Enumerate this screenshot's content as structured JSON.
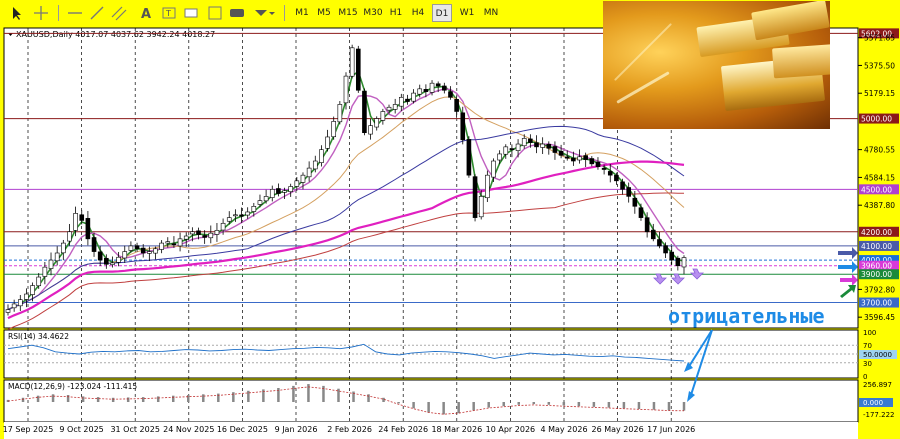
{
  "toolbar": {
    "timeframes": [
      "M1",
      "M5",
      "M15",
      "M30",
      "H1",
      "H4",
      "D1",
      "W1",
      "MN"
    ],
    "active_timeframe": "D1",
    "tools": [
      "cursor-icon",
      "crosshair-icon",
      "horizontal-line-icon",
      "trendline-icon",
      "channel-icon",
      "text-icon",
      "label-icon",
      "rectangle-icon",
      "shapes-icon"
    ]
  },
  "chart_data": {
    "type": "candlestick",
    "symbol_header": "XAUUSD,Daily  4017.07 4037.62 3942.24 4018.27",
    "x_ticks": [
      "17 Sep 2025",
      "9 Oct 2025",
      "31 Oct 2025",
      "24 Nov 2025",
      "16 Dec 2025",
      "9 Jan 2026",
      "2 Feb 2026",
      "24 Feb 2026",
      "18 Mar 2026",
      "10 Apr 2026",
      "4 May 2026",
      "26 May 2026",
      "17 Jun 2026"
    ],
    "y_ticks": [
      "5571.85",
      "5375.50",
      "5179.15",
      "4780.55",
      "4584.15",
      "4387.80",
      "3792.80",
      "3596.45"
    ],
    "ylim": [
      3520,
      5640
    ],
    "levels": [
      {
        "label": "5602.00",
        "value": 5602,
        "color": "#8b1a1a"
      },
      {
        "label": "5000.00",
        "value": 5000,
        "color": "#8b1a1a"
      },
      {
        "label": "4500.00",
        "value": 4500,
        "color": "#b040d0"
      },
      {
        "label": "4200.00",
        "value": 4200,
        "color": "#8b1a1a"
      },
      {
        "label": "4100.00",
        "value": 4100,
        "color": "#4a5aa8"
      },
      {
        "label": "4000.00",
        "value": 4000,
        "color": "#1a6fd8"
      },
      {
        "label": "3960.00",
        "value": 3960,
        "color": "#d83ad8"
      },
      {
        "label": "3900.00",
        "value": 3900,
        "color": "#1a8a3a"
      },
      {
        "label": "3700.00",
        "value": 3700,
        "color": "#3a6ac8"
      }
    ],
    "price_close": [
      3650,
      3690,
      3720,
      3760,
      3820,
      3880,
      3950,
      4000,
      4050,
      4120,
      4200,
      4330,
      4280,
      4150,
      4060,
      4000,
      3970,
      3980,
      4020,
      4060,
      4100,
      4080,
      4050,
      4060,
      4080,
      4120,
      4130,
      4110,
      4150,
      4170,
      4200,
      4180,
      4160,
      4190,
      4210,
      4260,
      4300,
      4320,
      4310,
      4340,
      4380,
      4420,
      4450,
      4500,
      4470,
      4490,
      4520,
      4560,
      4600,
      4650,
      4700,
      4780,
      4870,
      4980,
      5100,
      5300,
      5500,
      5200,
      4900,
      4950,
      5000,
      5050,
      5080,
      5100,
      5150,
      5120,
      5180,
      5210,
      5190,
      5250,
      5230,
      5200,
      5150,
      5050,
      4850,
      4600,
      4300,
      4450,
      4600,
      4700,
      4750,
      4800,
      4780,
      4820,
      4860,
      4830,
      4800,
      4820,
      4790,
      4760,
      4740,
      4720,
      4700,
      4730,
      4710,
      4680,
      4660,
      4640,
      4600,
      4560,
      4500,
      4450,
      4380,
      4300,
      4200,
      4150,
      4100,
      4050,
      4000,
      3960,
      4018
    ],
    "ma_lines": [
      {
        "name": "MA fast",
        "color": "#2e8b2e"
      },
      {
        "name": "MA mid",
        "color": "#c060c0"
      },
      {
        "name": "MA 50",
        "color": "#d4a060"
      },
      {
        "name": "MA 100",
        "color": "#3a3aa0"
      },
      {
        "name": "MA 200",
        "color": "#e020c0"
      },
      {
        "name": "MA 200 EMA",
        "color": "#c04040"
      }
    ],
    "rsi": {
      "label": "RSI(14) 34.4622",
      "levels": [
        "100",
        "70",
        "50.0000",
        "30",
        "0"
      ],
      "values": [
        62,
        66,
        70,
        64,
        55,
        52,
        50,
        54,
        56,
        55,
        57,
        58,
        55,
        56,
        58,
        60,
        59,
        57,
        58,
        60,
        61,
        59,
        58,
        60,
        62,
        63,
        65,
        64,
        62,
        66,
        72,
        55,
        50,
        48,
        52,
        54,
        56,
        55,
        53,
        50,
        46,
        40,
        44,
        48,
        52,
        50,
        48,
        49,
        47,
        45,
        44,
        46,
        43,
        42,
        40,
        38,
        36,
        34
      ]
    },
    "macd": {
      "label": "MACD(12,26,9) -123.024 -111.415",
      "ticks": [
        "256.897",
        "0.000",
        "-177.222"
      ],
      "hist": [
        30,
        60,
        90,
        110,
        100,
        80,
        70,
        60,
        65,
        70,
        80,
        90,
        100,
        110,
        120,
        140,
        160,
        180,
        200,
        230,
        256,
        230,
        190,
        150,
        110,
        60,
        -20,
        -90,
        -150,
        -177,
        -160,
        -120,
        -80,
        -60,
        -40,
        -30,
        -40,
        -50,
        -60,
        -70,
        -80,
        -90,
        -100,
        -110,
        -120,
        -123
      ]
    }
  },
  "annotation": {
    "text": "отрицательные",
    "color": "#1e8be6"
  }
}
